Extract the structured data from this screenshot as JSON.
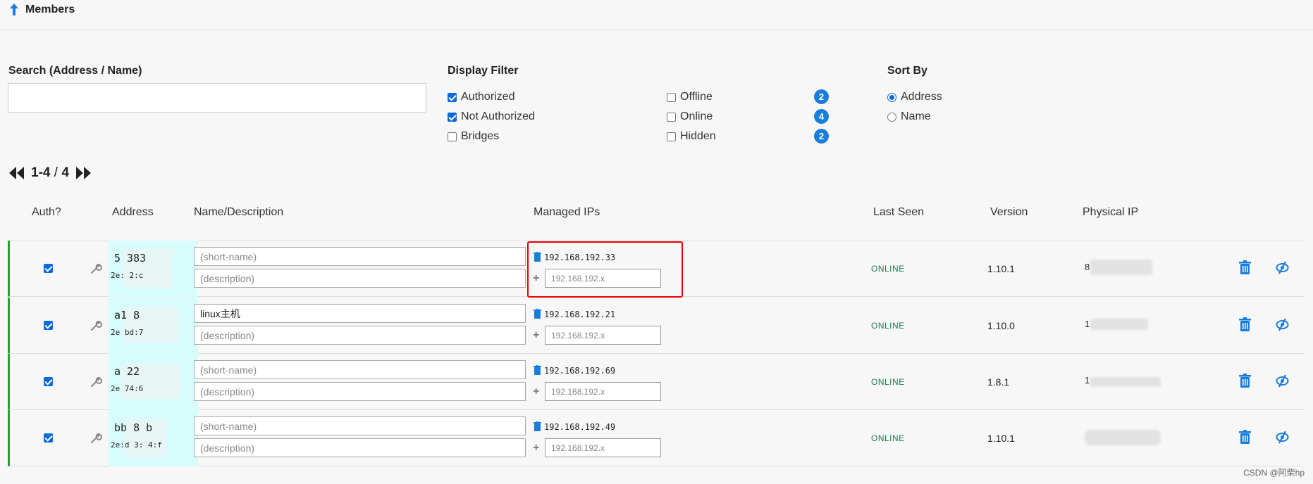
{
  "header": {
    "title": "Members"
  },
  "search": {
    "label": "Search (Address / Name)",
    "placeholder": ""
  },
  "display_filter": {
    "label": "Display Filter",
    "items": [
      {
        "label": "Authorized",
        "checked": true
      },
      {
        "label": "Not Authorized",
        "checked": true
      },
      {
        "label": "Bridges",
        "checked": false
      },
      {
        "label": "Offline",
        "checked": false,
        "count": "2"
      },
      {
        "label": "Online",
        "checked": false,
        "count": "4"
      },
      {
        "label": "Hidden",
        "checked": false,
        "count": "2"
      }
    ]
  },
  "sort_by": {
    "label": "Sort By",
    "options": [
      {
        "label": "Address",
        "selected": true
      },
      {
        "label": "Name",
        "selected": false
      }
    ]
  },
  "pagination": {
    "range": "1-4",
    "separator": "/",
    "total": "4"
  },
  "columns": [
    "Auth?",
    "Address",
    "Name/Description",
    "Managed IPs",
    "Last Seen",
    "Version",
    "Physical IP"
  ],
  "members": [
    {
      "authorized": true,
      "address_top": "5        383",
      "address_bottom": "2e:            2:c",
      "name": "",
      "name_placeholder": "(short-name)",
      "description_placeholder": "(description)",
      "managed_ip": "192.168.192.33",
      "ip_placeholder": "192.168.192.x",
      "last_seen": "ONLINE",
      "version": "1.10.1",
      "physical_ip": "8"
    },
    {
      "authorized": true,
      "address_top": "a1        8",
      "address_bottom": "2e            bd:7",
      "name": "linux主机",
      "name_placeholder": "(short-name)",
      "description_placeholder": "(description)",
      "managed_ip": "192.168.192.21",
      "ip_placeholder": "192.168.192.x",
      "last_seen": "ONLINE",
      "version": "1.10.0",
      "physical_ip": "1"
    },
    {
      "authorized": true,
      "address_top": "a        22",
      "address_bottom": "2e          74:6",
      "name": "",
      "name_placeholder": "(short-name)",
      "description_placeholder": "(description)",
      "managed_ip": "192.168.192.69",
      "ip_placeholder": "192.168.192.x",
      "last_seen": "ONLINE",
      "version": "1.8.1",
      "physical_ip": "1"
    },
    {
      "authorized": true,
      "address_top": "bb    8    b",
      "address_bottom": "2e:d     3:    4:f",
      "name": "",
      "name_placeholder": "(short-name)",
      "description_placeholder": "(description)",
      "managed_ip": "192.168.192.49",
      "ip_placeholder": "192.168.192.x",
      "last_seen": "ONLINE",
      "version": "1.10.1",
      "physical_ip": ""
    }
  ],
  "watermark": "CSDN @阿柴hp",
  "colors": {
    "accent": "#1a7ddb",
    "online": "#1a7a4a",
    "row_border": "#2e9e3a",
    "address_bg": "#d7fcfc",
    "highlight": "#ee0000"
  },
  "icons": [
    "arrow-up-icon",
    "wrench-icon",
    "trash-icon",
    "plus-icon",
    "hide-icon",
    "first-page-icon",
    "last-page-icon"
  ]
}
